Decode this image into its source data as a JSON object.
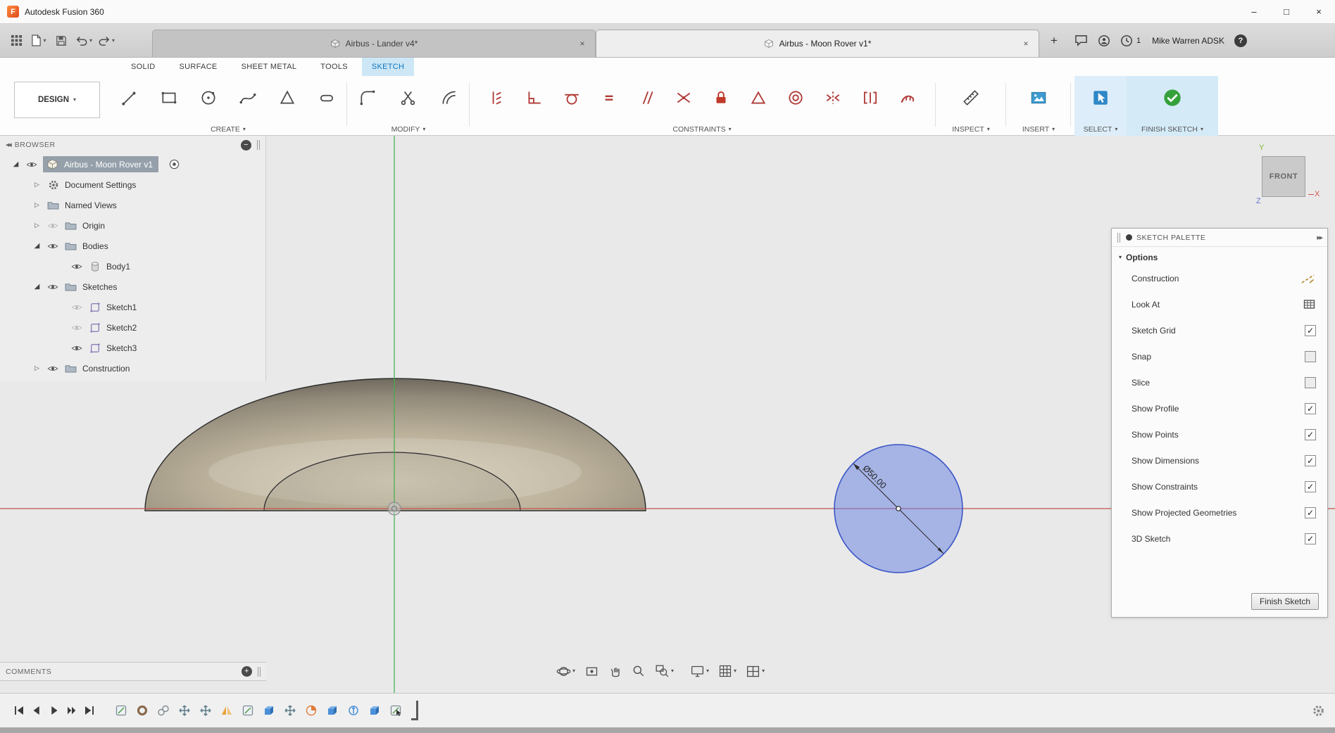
{
  "window": {
    "title": "Autodesk Fusion 360",
    "controls": {
      "minimize": "–",
      "maximize": "□",
      "close": "×"
    }
  },
  "icons": {
    "caret": "▾",
    "tri_collapsed": "▷",
    "tri_expanded": "◢",
    "collapse_left": "◀◀",
    "collapse_right": "▶▶",
    "checkmark": "✓",
    "panel_minus": "−",
    "panel_plus": "+",
    "tab_close": "×",
    "new_tab": "+",
    "help": "?"
  },
  "appbar": {
    "tabs": [
      {
        "label": "Airbus - Lander v4*",
        "active": false
      },
      {
        "label": "Airbus - Moon Rover v1*",
        "active": true
      }
    ],
    "jobs_badge": "1",
    "user": "Mike Warren ADSK"
  },
  "ribbon": {
    "workspace": "DESIGN",
    "tabs": [
      {
        "label": "SOLID",
        "active": false
      },
      {
        "label": "SURFACE",
        "active": false
      },
      {
        "label": "SHEET METAL",
        "active": false
      },
      {
        "label": "TOOLS",
        "active": false
      },
      {
        "label": "SKETCH",
        "active": true
      }
    ],
    "groups": {
      "create": "CREATE",
      "modify": "MODIFY",
      "constraints": "CONSTRAINTS",
      "inspect": "INSPECT",
      "insert": "INSERT",
      "select": "SELECT",
      "finish": "FINISH SKETCH"
    }
  },
  "browser": {
    "title": "BROWSER",
    "items": [
      {
        "label": "Airbus - Moon Rover v1",
        "selected": true,
        "hidden": false
      },
      {
        "label": "Document Settings"
      },
      {
        "label": "Named Views"
      },
      {
        "label": "Origin",
        "hidden": true
      },
      {
        "label": "Bodies",
        "hidden": false
      },
      {
        "label": "Body1",
        "hidden": false
      },
      {
        "label": "Sketches",
        "hidden": false
      },
      {
        "label": "Sketch1",
        "hidden": true
      },
      {
        "label": "Sketch2",
        "hidden": true
      },
      {
        "label": "Sketch3",
        "hidden": false
      },
      {
        "label": "Construction",
        "hidden": false
      }
    ]
  },
  "viewcube": {
    "face": "FRONT",
    "axis_y": "Y",
    "axis_x": "X",
    "axis_z": "Z"
  },
  "canvas": {
    "dimension": "Ø50.00"
  },
  "sketch_palette": {
    "title": "SKETCH PALETTE",
    "section": "Options",
    "rows": [
      {
        "label": "Construction",
        "control": "construction-icon"
      },
      {
        "label": "Look At",
        "control": "look-at-icon"
      },
      {
        "label": "Sketch Grid",
        "control": "checkbox",
        "checked": true
      },
      {
        "label": "Snap",
        "control": "checkbox",
        "checked": false
      },
      {
        "label": "Slice",
        "control": "checkbox",
        "checked": false
      },
      {
        "label": "Show Profile",
        "control": "checkbox",
        "checked": true
      },
      {
        "label": "Show Points",
        "control": "checkbox",
        "checked": true
      },
      {
        "label": "Show Dimensions",
        "control": "checkbox",
        "checked": true
      },
      {
        "label": "Show Constraints",
        "control": "checkbox",
        "checked": true
      },
      {
        "label": "Show Projected Geometries",
        "control": "checkbox",
        "checked": true
      },
      {
        "label": "3D Sketch",
        "control": "checkbox",
        "checked": true
      }
    ],
    "finish_button": "Finish Sketch"
  },
  "comments": {
    "title": "COMMENTS"
  },
  "timeline": {
    "features": [
      "sketch",
      "form",
      "sketch",
      "move",
      "move",
      "mirror",
      "sketch",
      "extrude",
      "move",
      "revolve",
      "extrude",
      "offset",
      "extrude",
      "sketch"
    ]
  }
}
